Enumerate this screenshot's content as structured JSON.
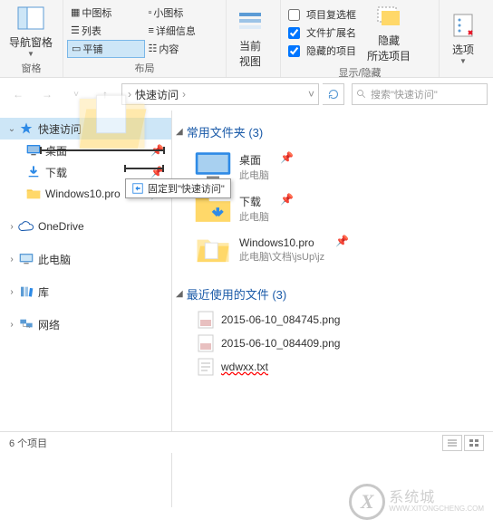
{
  "ribbon": {
    "pane": {
      "nav_pane": "导航窗格",
      "group": "窗格"
    },
    "layout": {
      "med_icons": "中图标",
      "small_icons": "小图标",
      "list": "列表",
      "details": "详细信息",
      "tiles": "平铺",
      "content": "内容",
      "group": "布局"
    },
    "view": {
      "current_view": "当前\n视图",
      "item_checkbox": "项目复选框",
      "file_ext": "文件扩展名",
      "hidden_items": "隐藏的项目",
      "hide_selected": "隐藏\n所选项目",
      "group": "显示/隐藏"
    },
    "options": "选项"
  },
  "nav": {
    "breadcrumb": "快速访问",
    "search_placeholder": "搜索\"快速访问\""
  },
  "tooltip": "固定到\"快速访问\"",
  "sidebar": {
    "quick_access": "快速访问",
    "desktop": "桌面",
    "downloads": "下载",
    "win10pro": "Windows10.pro",
    "onedrive": "OneDrive",
    "thispc": "此电脑",
    "libraries": "库",
    "network": "网络"
  },
  "main": {
    "freq_folders": {
      "title": "常用文件夹 (3)",
      "items": [
        {
          "name": "桌面",
          "sub": "此电脑"
        },
        {
          "name": "下载",
          "sub": "此电脑"
        },
        {
          "name": "Windows10.pro",
          "sub": "此电脑\\文档\\jsUp\\jz"
        }
      ]
    },
    "recent_files": {
      "title": "最近使用的文件 (3)",
      "items": [
        {
          "name": "2015-06-10_084745.png"
        },
        {
          "name": "2015-06-10_084409.png"
        },
        {
          "name": "wdwxx.txt"
        }
      ]
    }
  },
  "status": "6 个项目",
  "watermark": {
    "name": "系统城",
    "url": "WWW.XITONGCHENG.COM"
  }
}
